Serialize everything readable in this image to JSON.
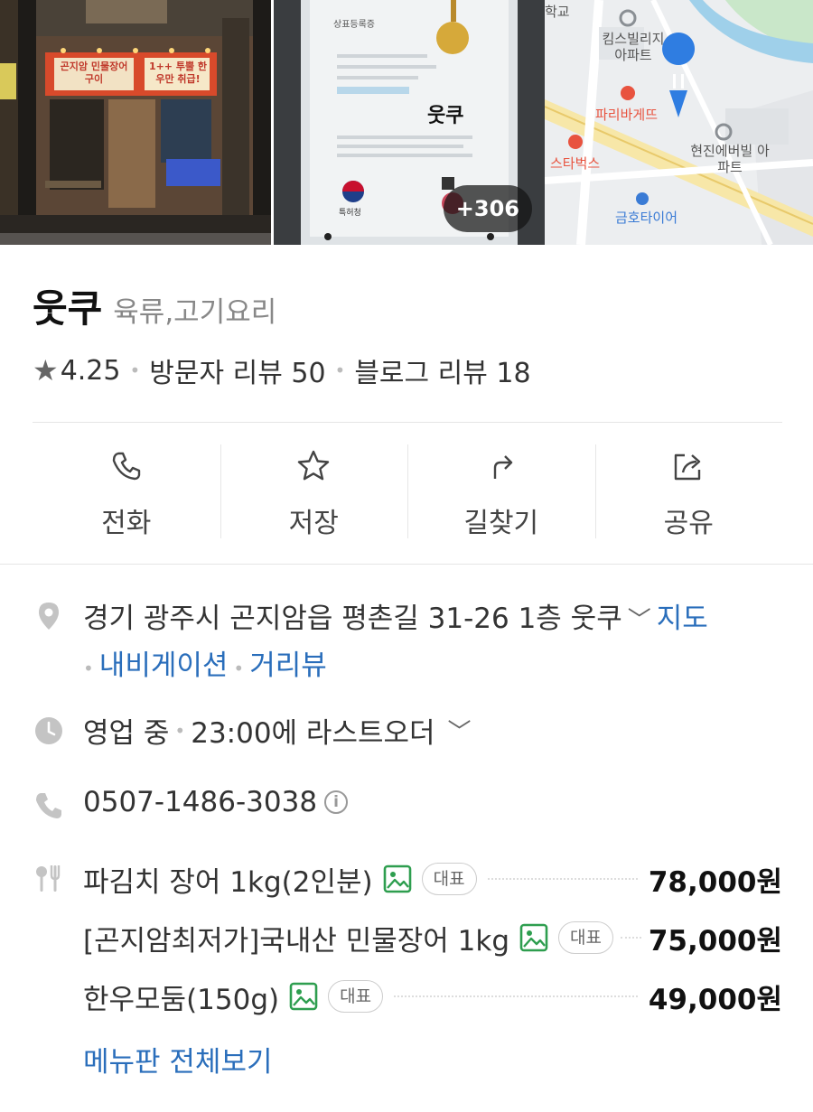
{
  "photos": {
    "storefront_sign_1": "곤지암 민물장어구이",
    "storefront_sign_2": "1++ 투뿔 한우만 취급!",
    "certificate_title": "상표등록증",
    "certificate_brand": "웃쿠",
    "certificate_issuer": "특허청",
    "more_count": "+306"
  },
  "map": {
    "labels": [
      "학교",
      "킴스빌리지 아파트",
      "파리바게뜨",
      "스타벅스",
      "현진에버빌 아파트",
      "금호타이어"
    ],
    "pin_icon": "restaurant-pin-icon"
  },
  "place": {
    "name": "웃쿠",
    "category": "육류,고기요리",
    "rating": "4.25",
    "visitor_reviews": "방문자 리뷰 50",
    "blog_reviews": "블로그 리뷰 18"
  },
  "actions": [
    {
      "label": "전화",
      "icon": "phone-icon"
    },
    {
      "label": "저장",
      "icon": "star-icon"
    },
    {
      "label": "길찾기",
      "icon": "directions-icon"
    },
    {
      "label": "공유",
      "icon": "share-icon"
    }
  ],
  "info": {
    "address": "경기 광주시 곤지암읍 평촌길 31-26 1층 웃쿠",
    "map_link": "지도",
    "navigation_link": "내비게이션",
    "street_view_link": "거리뷰",
    "status": "영업 중",
    "last_order": "23:00에 라스트오더",
    "phone": "0507-1486-3038"
  },
  "menu": {
    "items": [
      {
        "name": "파김치 장어 1kg(2인분)",
        "badge": "대표",
        "price": "78,000원"
      },
      {
        "name": "[곤지암최저가]국내산 민물장어 1kg",
        "badge": "대표",
        "price": "75,000원"
      },
      {
        "name": "한우모둠(150g)",
        "badge": "대표",
        "price": "49,000원"
      }
    ],
    "view_all": "메뉴판 전체보기"
  },
  "colors": {
    "link": "#2a6ebb",
    "photo_icon": "#2e9e4f",
    "map_pin": "#2f7de1"
  }
}
